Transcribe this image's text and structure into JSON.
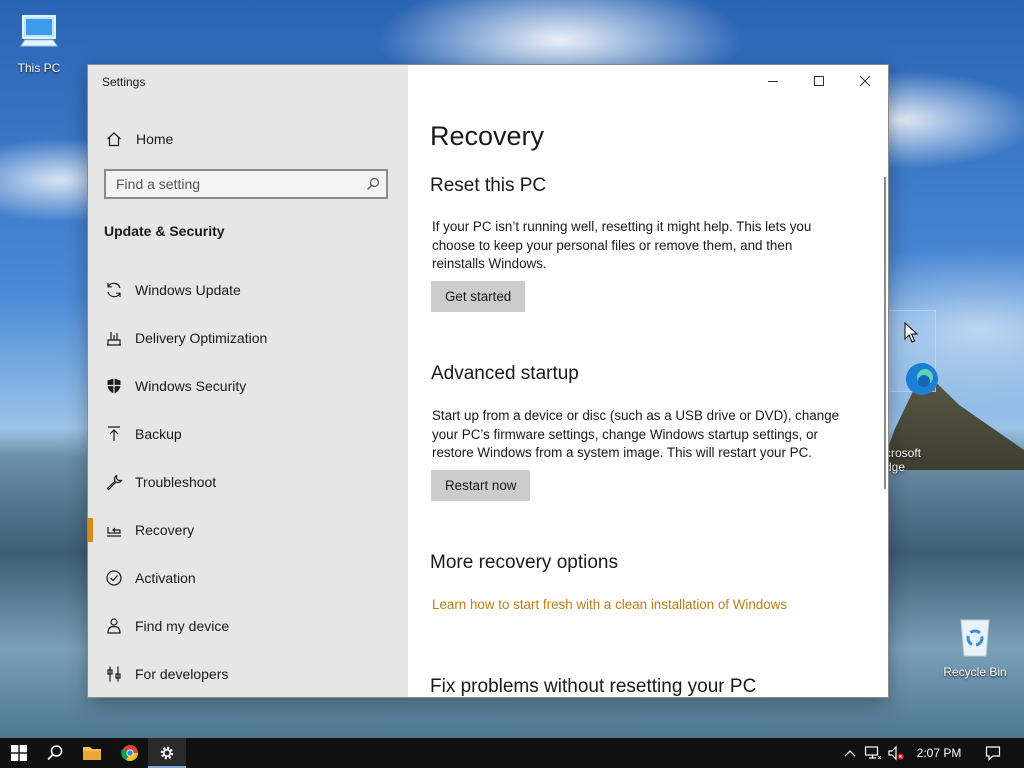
{
  "desktop": {
    "icons": [
      {
        "label": "This PC"
      },
      {
        "label": "crosoft\ndge"
      },
      {
        "label": "Recycle Bin"
      }
    ]
  },
  "window": {
    "title": "Settings",
    "sidebar": {
      "home_label": "Home",
      "search_placeholder": "Find a setting",
      "section_heading": "Update & Security",
      "items": [
        {
          "label": "Windows Update",
          "icon": "sync-icon"
        },
        {
          "label": "Delivery Optimization",
          "icon": "delivery-optimization-icon"
        },
        {
          "label": "Windows Security",
          "icon": "shield-icon"
        },
        {
          "label": "Backup",
          "icon": "backup-arrow-icon"
        },
        {
          "label": "Troubleshoot",
          "icon": "wrench-icon"
        },
        {
          "label": "Recovery",
          "icon": "recovery-icon",
          "selected": true
        },
        {
          "label": "Activation",
          "icon": "check-circle-icon"
        },
        {
          "label": "Find my device",
          "icon": "person-location-icon"
        },
        {
          "label": "For developers",
          "icon": "developer-tools-icon"
        }
      ]
    },
    "content": {
      "page_title": "Recovery",
      "reset": {
        "heading": "Reset this PC",
        "description": "If your PC isn’t running well, resetting it might help. This lets you choose to keep your personal files or remove them, and then reinstalls Windows.",
        "button": "Get started"
      },
      "advanced": {
        "heading": "Advanced startup",
        "description": "Start up from a device or disc (such as a USB drive or DVD), change your PC’s firmware settings, change Windows startup settings, or restore Windows from a system image. This will restart your PC.",
        "button": "Restart now"
      },
      "more": {
        "heading": "More recovery options",
        "link": "Learn how to start fresh with a clean installation of Windows"
      },
      "fix": {
        "heading": "Fix problems without resetting your PC"
      }
    }
  },
  "taskbar": {
    "clock": "2:07 PM"
  },
  "colors": {
    "accent": "#d68c1d",
    "link": "#c17d11",
    "sidebar_bg": "#e6e6e6",
    "button_bg": "#cccccc"
  }
}
